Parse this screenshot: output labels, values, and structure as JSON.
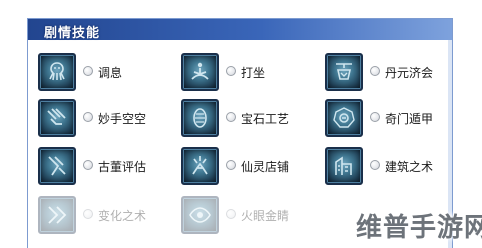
{
  "panel": {
    "title": "剧情技能"
  },
  "skills": [
    {
      "label": "调息",
      "icon": "octopus-icon"
    },
    {
      "label": "打坐",
      "icon": "meditation-icon"
    },
    {
      "label": "丹元济会",
      "icon": "cauldron-icon"
    },
    {
      "label": "妙手空空",
      "icon": "claw-hand-icon"
    },
    {
      "label": "宝石工艺",
      "icon": "gem-icon"
    },
    {
      "label": "奇门遁甲",
      "icon": "compass-icon"
    },
    {
      "label": "古董评估",
      "icon": "vase-icon"
    },
    {
      "label": "仙灵店铺",
      "icon": "spirit-shop-icon"
    },
    {
      "label": "建筑之术",
      "icon": "building-icon"
    },
    {
      "label": "变化之术",
      "icon": "transform-icon"
    },
    {
      "label": "火眼金睛",
      "icon": "eye-icon"
    }
  ],
  "watermark": "维普手游网"
}
